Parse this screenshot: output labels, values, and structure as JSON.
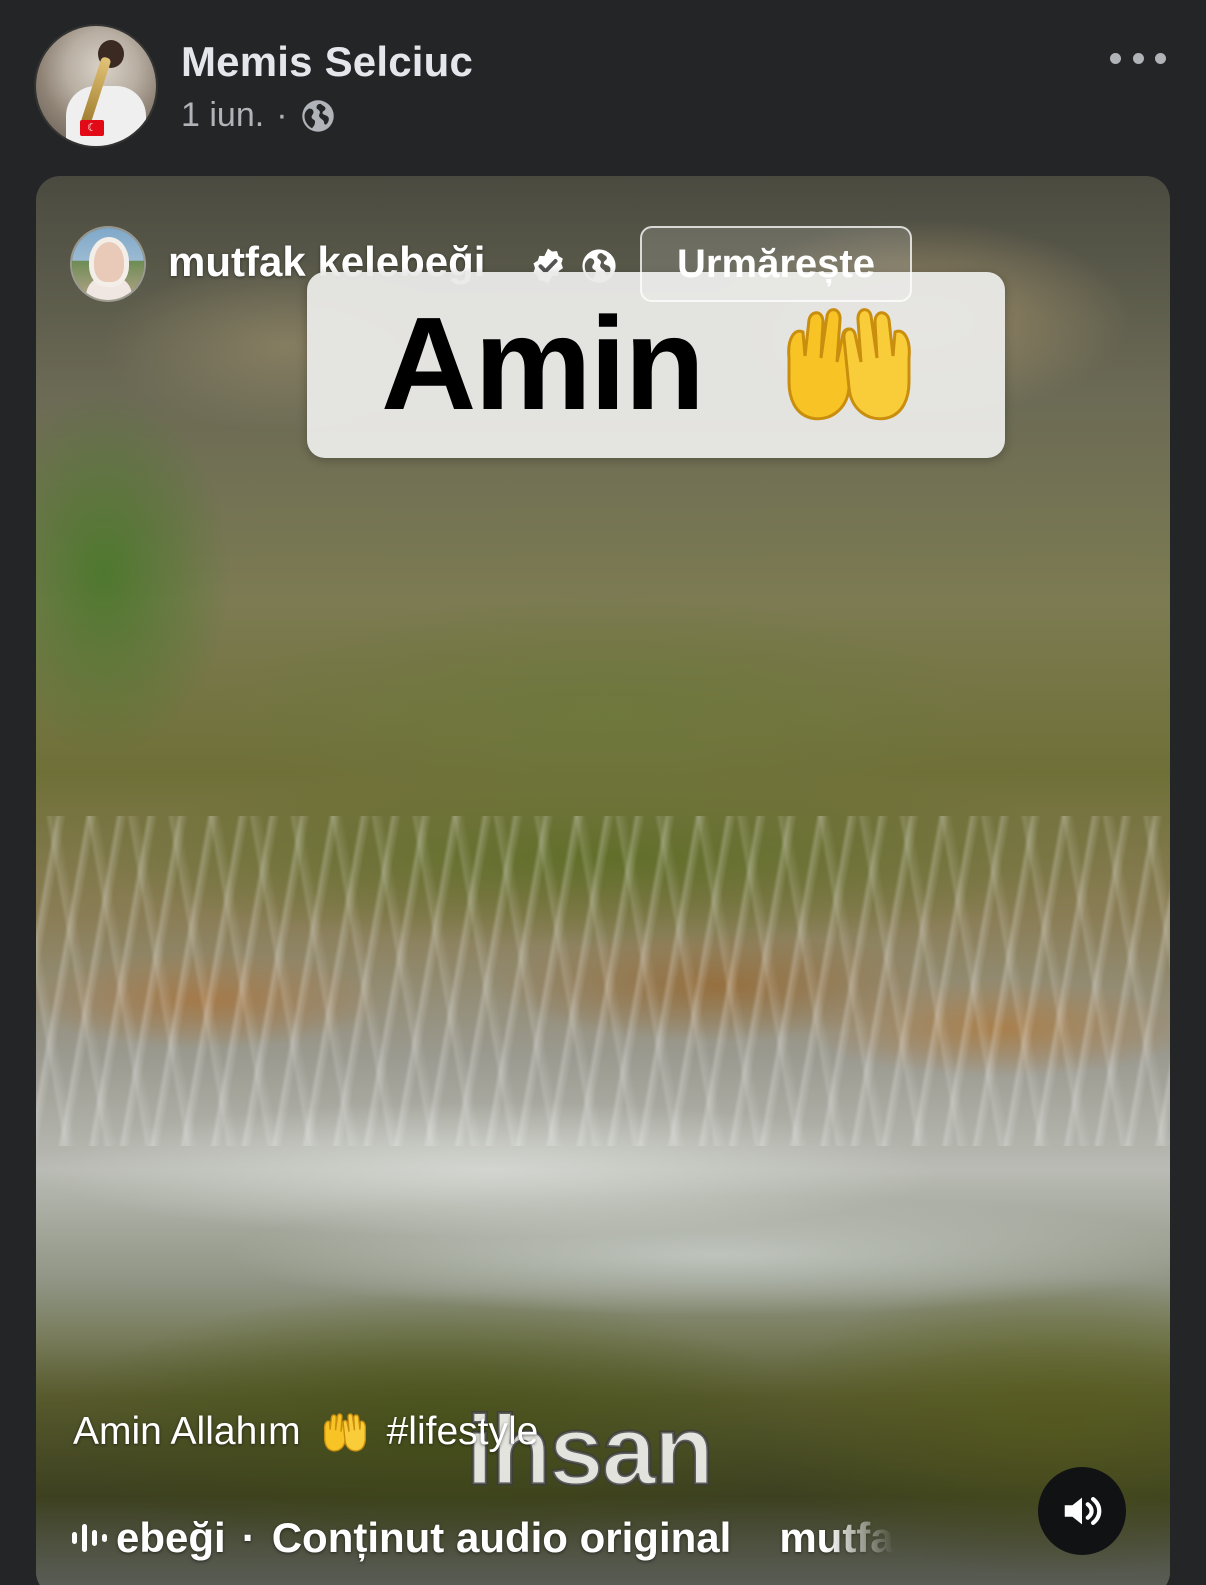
{
  "post": {
    "author_name": "Memis Selciuc",
    "date": "1 iun.",
    "separator": "·",
    "privacy_icon": "globe-icon",
    "more_icon": "more-horizontal-icon"
  },
  "reel": {
    "author_name": "mutfak kelebeği",
    "verified_icon": "verified-badge-icon",
    "privacy_icon": "globe-icon",
    "follow_label": "Urmărește",
    "sticker_text": "Amin",
    "sticker_emoji": "palms-up-together-emoji",
    "caption_text": "Amin Allahım",
    "caption_emoji": "palms-up-together-emoji",
    "caption_hashtag": "#lifestyle",
    "watermark_text": "ihsan",
    "audio": {
      "icon": "audio-bars-icon",
      "author_fragment": "ebeği",
      "separator": "·",
      "label": "Conținut audio original",
      "trailing_fragment": "mutfa"
    },
    "volume_icon": "speaker-volume-icon"
  },
  "colors": {
    "background": "#242526",
    "primary_text": "#e4e6eb",
    "secondary_text": "#b0b3b8",
    "flag_red": "#e30a17",
    "emoji_yellow": "#f7c325"
  }
}
